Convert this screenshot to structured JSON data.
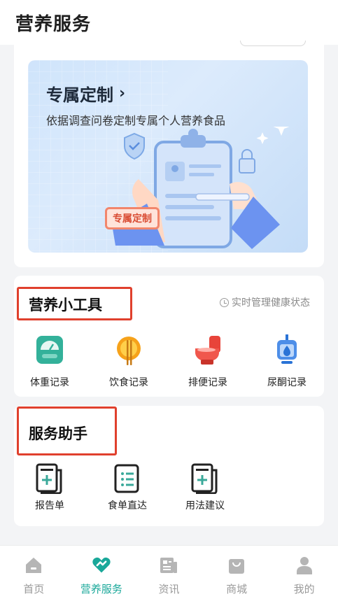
{
  "header": {
    "title": "营养服务"
  },
  "banner": {
    "title": "专属定制",
    "arrow": "›",
    "subtitle": "依据调查问卷定制专属个人营养食品",
    "badge": "专属定制"
  },
  "tools": {
    "title": "营养小工具",
    "hint": "实时管理健康状态",
    "items": [
      {
        "label": "体重记录",
        "icon": "scale-icon"
      },
      {
        "label": "饮食记录",
        "icon": "food-icon"
      },
      {
        "label": "排便记录",
        "icon": "toilet-icon"
      },
      {
        "label": "尿酮记录",
        "icon": "drip-icon"
      }
    ]
  },
  "services": {
    "title": "服务助手",
    "items": [
      {
        "label": "报告单",
        "icon": "report-icon"
      },
      {
        "label": "食单直达",
        "icon": "menu-icon"
      },
      {
        "label": "用法建议",
        "icon": "advice-icon"
      }
    ]
  },
  "nav": {
    "items": [
      {
        "label": "首页",
        "icon": "home-icon"
      },
      {
        "label": "营养服务",
        "icon": "heart-handshake-icon",
        "active": true
      },
      {
        "label": "资讯",
        "icon": "news-icon"
      },
      {
        "label": "商城",
        "icon": "shop-icon"
      },
      {
        "label": "我的",
        "icon": "profile-icon"
      }
    ]
  },
  "colors": {
    "accent": "#1aa89a",
    "highlight": "#e0402d",
    "inactive": "#9a9a9a"
  }
}
